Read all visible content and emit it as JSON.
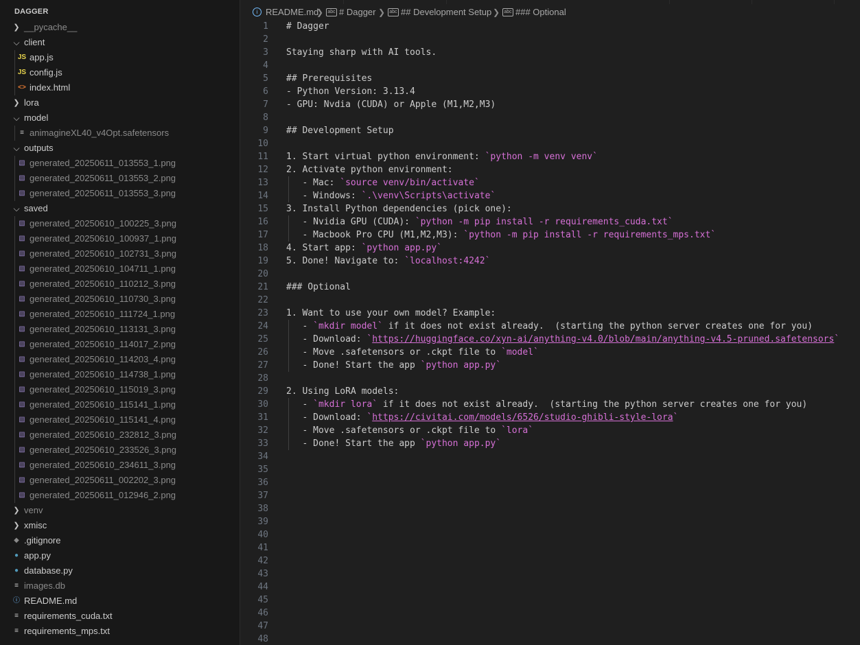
{
  "explorer": {
    "title": "DAGGER",
    "items": [
      {
        "label": "__pycache__",
        "kind": "folder",
        "expanded": false,
        "dim": true
      },
      {
        "label": "client",
        "kind": "folder",
        "expanded": true,
        "dim": false
      },
      {
        "label": "app.js",
        "kind": "js",
        "dim": false
      },
      {
        "label": "config.js",
        "kind": "js",
        "dim": false
      },
      {
        "label": "index.html",
        "kind": "html",
        "dim": false
      },
      {
        "label": "lora",
        "kind": "folder",
        "expanded": false,
        "dim": false
      },
      {
        "label": "model",
        "kind": "folder",
        "expanded": true,
        "dim": false
      },
      {
        "label": "animagineXL40_v4Opt.safetensors",
        "kind": "file",
        "dim": true
      },
      {
        "label": "outputs",
        "kind": "folder",
        "expanded": true,
        "dim": false
      },
      {
        "label": "generated_20250611_013553_1.png",
        "kind": "image",
        "dim": true
      },
      {
        "label": "generated_20250611_013553_2.png",
        "kind": "image",
        "dim": true
      },
      {
        "label": "generated_20250611_013553_3.png",
        "kind": "image",
        "dim": true
      },
      {
        "label": "saved",
        "kind": "folder",
        "expanded": true,
        "dim": false
      },
      {
        "label": "generated_20250610_100225_3.png",
        "kind": "image",
        "dim": true
      },
      {
        "label": "generated_20250610_100937_1.png",
        "kind": "image",
        "dim": true
      },
      {
        "label": "generated_20250610_102731_3.png",
        "kind": "image",
        "dim": true
      },
      {
        "label": "generated_20250610_104711_1.png",
        "kind": "image",
        "dim": true
      },
      {
        "label": "generated_20250610_110212_3.png",
        "kind": "image",
        "dim": true
      },
      {
        "label": "generated_20250610_110730_3.png",
        "kind": "image",
        "dim": true
      },
      {
        "label": "generated_20250610_111724_1.png",
        "kind": "image",
        "dim": true
      },
      {
        "label": "generated_20250610_113131_3.png",
        "kind": "image",
        "dim": true
      },
      {
        "label": "generated_20250610_114017_2.png",
        "kind": "image",
        "dim": true
      },
      {
        "label": "generated_20250610_114203_4.png",
        "kind": "image",
        "dim": true
      },
      {
        "label": "generated_20250610_114738_1.png",
        "kind": "image",
        "dim": true
      },
      {
        "label": "generated_20250610_115019_3.png",
        "kind": "image",
        "dim": true
      },
      {
        "label": "generated_20250610_115141_1.png",
        "kind": "image",
        "dim": true
      },
      {
        "label": "generated_20250610_115141_4.png",
        "kind": "image",
        "dim": true
      },
      {
        "label": "generated_20250610_232812_3.png",
        "kind": "image",
        "dim": true
      },
      {
        "label": "generated_20250610_233526_3.png",
        "kind": "image",
        "dim": true
      },
      {
        "label": "generated_20250610_234611_3.png",
        "kind": "image",
        "dim": true
      },
      {
        "label": "generated_20250611_002202_3.png",
        "kind": "image",
        "dim": true
      },
      {
        "label": "generated_20250611_012946_2.png",
        "kind": "image",
        "dim": true
      },
      {
        "label": "venv",
        "kind": "folder",
        "expanded": false,
        "dim": true
      },
      {
        "label": "xmisc",
        "kind": "folder",
        "expanded": false,
        "dim": false
      },
      {
        "label": ".gitignore",
        "kind": "git",
        "dim": false
      },
      {
        "label": "app.py",
        "kind": "py",
        "dim": false
      },
      {
        "label": "database.py",
        "kind": "py",
        "dim": false
      },
      {
        "label": "images.db",
        "kind": "file",
        "dim": true
      },
      {
        "label": "README.md",
        "kind": "info",
        "dim": false
      },
      {
        "label": "requirements_cuda.txt",
        "kind": "lines",
        "dim": false
      },
      {
        "label": "requirements_mps.txt",
        "kind": "lines",
        "dim": false
      }
    ]
  },
  "breadcrumb": {
    "file": "README.md",
    "sections": [
      "# Dagger",
      "## Development Setup",
      "### Optional"
    ]
  },
  "editor": {
    "lines": [
      [
        {
          "t": "# Dagger"
        }
      ],
      [],
      [
        {
          "t": "Staying sharp with AI tools."
        }
      ],
      [],
      [
        {
          "t": "## Prerequisites"
        }
      ],
      [
        {
          "t": "- Python Version: 3.13.4"
        }
      ],
      [
        {
          "t": "- GPU: Nvdia (CUDA) or Apple (M1,M2,M3)"
        }
      ],
      [],
      [
        {
          "t": "## Development Setup"
        }
      ],
      [],
      [
        {
          "t": "1. Start virtual python environment: "
        },
        {
          "t": "`python -m venv venv`",
          "c": "pink"
        }
      ],
      [
        {
          "t": "2. Activate python environment:"
        }
      ],
      [
        {
          "t": "   - Mac: "
        },
        {
          "t": "`source venv/bin/activate`",
          "c": "pink"
        }
      ],
      [
        {
          "t": "   - Windows: "
        },
        {
          "t": "`.\\venv\\Scripts\\activate`",
          "c": "pink"
        }
      ],
      [
        {
          "t": "3. Install Python dependencies (pick one):"
        }
      ],
      [
        {
          "t": "   - Nvidia GPU (CUDA): "
        },
        {
          "t": "`python -m pip install -r requirements_cuda.txt`",
          "c": "pink"
        }
      ],
      [
        {
          "t": "   - Macbook Pro CPU (M1,M2,M3): "
        },
        {
          "t": "`python -m pip install -r requirements_mps.txt`",
          "c": "pink"
        }
      ],
      [
        {
          "t": "4. Start app: "
        },
        {
          "t": "`python app.py`",
          "c": "pink"
        }
      ],
      [
        {
          "t": "5. Done! Navigate to: "
        },
        {
          "t": "`localhost:4242`",
          "c": "pink"
        }
      ],
      [],
      [
        {
          "t": "### Optional"
        }
      ],
      [],
      [
        {
          "t": "1. Want to use your own model? Example:"
        }
      ],
      [
        {
          "t": "   - "
        },
        {
          "t": "`mkdir model`",
          "c": "pink"
        },
        {
          "t": " if it does not exist already.  (starting the python server creates one for you)"
        }
      ],
      [
        {
          "t": "   - Download: "
        },
        {
          "t": "`",
          "c": "pink"
        },
        {
          "t": "https://huggingface.co/xyn-ai/anything-v4.0/blob/main/anything-v4.5-pruned.safetensors",
          "c": "link"
        },
        {
          "t": "`",
          "c": "pink"
        }
      ],
      [
        {
          "t": "   - Move .safetensors or .ckpt file to "
        },
        {
          "t": "`model`",
          "c": "pink"
        }
      ],
      [
        {
          "t": "   - Done! Start the app "
        },
        {
          "t": "`python app.py`",
          "c": "pink"
        }
      ],
      [],
      [
        {
          "t": "2. Using LoRA models:"
        }
      ],
      [
        {
          "t": "   - "
        },
        {
          "t": "`mkdir lora`",
          "c": "pink"
        },
        {
          "t": " if it does not exist already.  (starting the python server creates one for you)"
        }
      ],
      [
        {
          "t": "   - Download: "
        },
        {
          "t": "`",
          "c": "pink"
        },
        {
          "t": "https://civitai.com/models/6526/studio-ghibli-style-lora",
          "c": "link"
        },
        {
          "t": "`",
          "c": "pink"
        }
      ],
      [
        {
          "t": "   - Move .safetensors or .ckpt file to "
        },
        {
          "t": "`lora`",
          "c": "pink"
        }
      ],
      [
        {
          "t": "   - Done! Start the app "
        },
        {
          "t": "`python app.py`",
          "c": "pink"
        }
      ],
      [],
      [],
      [],
      [],
      [],
      [],
      [],
      [],
      [],
      [],
      [],
      [],
      [],
      [],
      []
    ]
  }
}
